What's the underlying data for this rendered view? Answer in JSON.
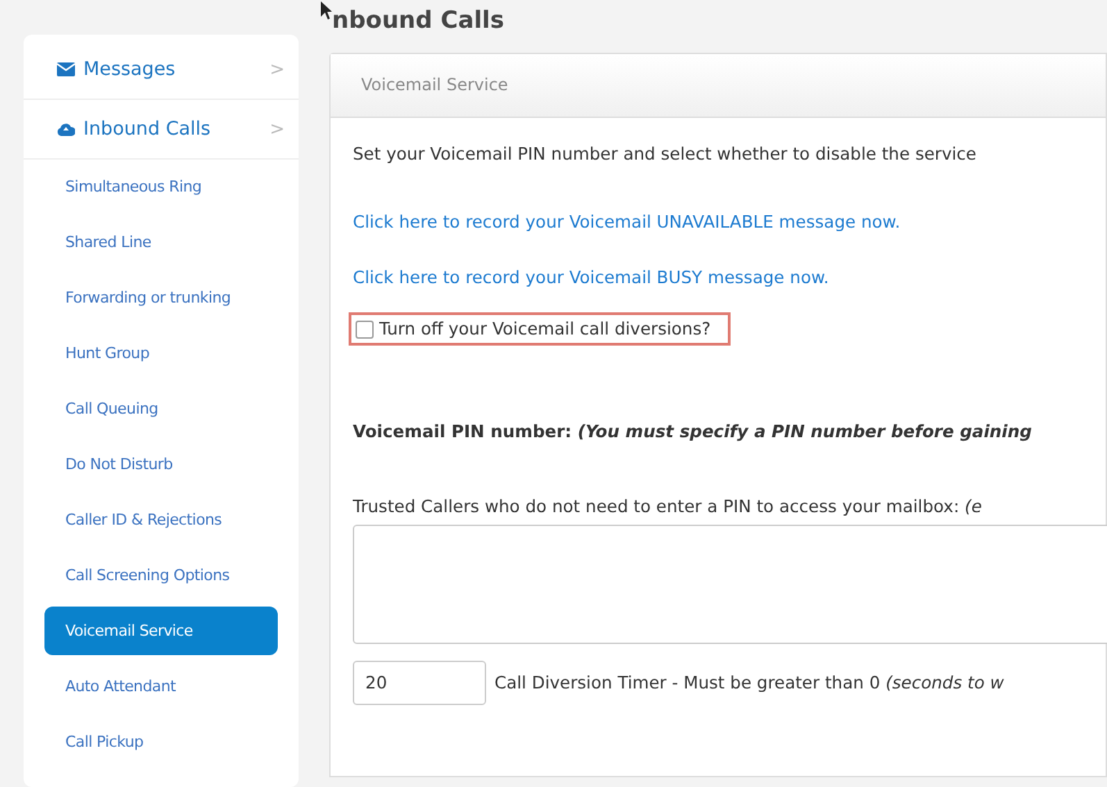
{
  "page_title": "nbound Calls",
  "sidebar": {
    "items": [
      {
        "kind": "section",
        "label": "Messages",
        "chevron": ">",
        "selected": false
      },
      {
        "kind": "section",
        "label": "Inbound Calls",
        "chevron": ">",
        "selected": false
      },
      {
        "kind": "link",
        "label": "Simultaneous Ring",
        "selected": false
      },
      {
        "kind": "link",
        "label": "Shared Line",
        "selected": false
      },
      {
        "kind": "link",
        "label": "Forwarding or trunking",
        "selected": false
      },
      {
        "kind": "link",
        "label": "Hunt Group",
        "selected": false
      },
      {
        "kind": "link",
        "label": "Call Queuing",
        "selected": false
      },
      {
        "kind": "link",
        "label": "Do Not Disturb",
        "selected": false
      },
      {
        "kind": "link",
        "label": "Caller ID & Rejections",
        "selected": false
      },
      {
        "kind": "link",
        "label": "Call Screening Options",
        "selected": false
      },
      {
        "kind": "link",
        "label": "Voicemail Service",
        "selected": true
      },
      {
        "kind": "link",
        "label": "Auto Attendant",
        "selected": false
      },
      {
        "kind": "link",
        "label": "Call Pickup",
        "selected": false
      }
    ]
  },
  "panel": {
    "title": "Voicemail Service",
    "intro": "Set your Voicemail PIN number and select whether to disable the service",
    "links": [
      "Click here to record your Voicemail UNAVAILABLE message now.",
      "Click here to record your Voicemail BUSY message now."
    ],
    "diversion_checkbox": {
      "label": "Turn off your Voicemail call diversions?",
      "checked": false,
      "highlighted": true
    },
    "pin_label": "Voicemail PIN number: *(You must specify a PIN number before gaining*",
    "trusted_label": "Trusted Callers who do not need to enter a PIN to access your mailbox: *(e*",
    "timer": {
      "value": "20",
      "label": "Call Diversion Timer - Must be greater than 0 *(seconds to w*"
    }
  }
}
